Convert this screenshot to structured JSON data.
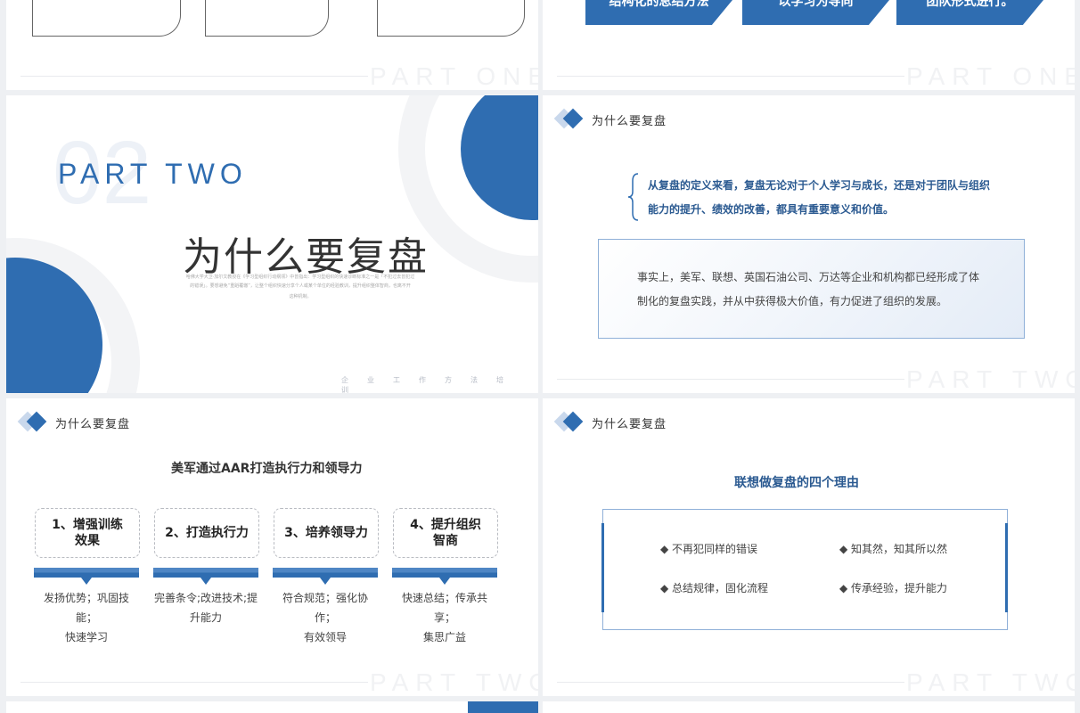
{
  "colors": {
    "accent": "#2f6db1",
    "dark_text": "#333333",
    "watermark": "#f1f2f4",
    "background": "#eef0f3"
  },
  "watermarks": {
    "part_one": "PART ONE",
    "part_two": "PART TWO"
  },
  "slide_top_right": {
    "tags": [
      "结构化的总结方法",
      "以学习为导向",
      "团队形式进行。"
    ]
  },
  "section_slide": {
    "number": "02",
    "part_label": "PART TWO",
    "title": "为什么要复盘",
    "tiny_paragraph_line1": "哈佛大学大卫·加尔文教授在《学习型组织行动纲领》中曾指出：学习型组织的快速诊断标准之一是「不犯过去曾犯过",
    "tiny_paragraph_line2": "的错误」。要想避免“重蹈覆辙”，让整个组织快速分享个人或某个单位的经验教训，提升组织整体智商，也离不开",
    "tiny_paragraph_line3": "这种机制。",
    "footer_letters": "企业工作方法培训"
  },
  "why_slide_1": {
    "header": "为什么要复盘",
    "brace_line1": "从复盘的定义来看，复盘无论对于个人学习与成长，还是对于团队与组织",
    "brace_line2": "能力的提升、绩效的改善，都具有重要意义和价值。",
    "fact_line1": "事实上，美军、联想、英国石油公司、万达等企业和机构都已经形成了体",
    "fact_line2": "制化的复盘实践，并从中获得极大价值，有力促进了组织的发展。"
  },
  "aar_slide": {
    "header": "为什么要复盘",
    "title": "美军通过AAR打造执行力和领导力",
    "items": [
      {
        "box_line1": "1、增强训练",
        "box_line2": "效果",
        "desc_line1": "发扬优势；巩固技能；",
        "desc_line2": "快速学习"
      },
      {
        "box_line1": "2、打造执行力",
        "box_line2": "",
        "desc_line1": "完善条令;改进技术;提",
        "desc_line2": "升能力"
      },
      {
        "box_line1": "3、培养领导力",
        "box_line2": "",
        "desc_line1": "符合规范；强化协作；",
        "desc_line2": "有效领导"
      },
      {
        "box_line1": "4、提升组织",
        "box_line2": "智商",
        "desc_line1": "快速总结；传承共享；",
        "desc_line2": "集思广益"
      }
    ]
  },
  "lenovo_slide": {
    "header": "为什么要复盘",
    "title": "联想做复盘的四个理由",
    "reasons": [
      "◆ 不再犯同样的错误",
      "◆ 知其然，知其所以然",
      "◆ 总结规律，固化流程",
      "◆ 传承经验，提升能力"
    ]
  }
}
